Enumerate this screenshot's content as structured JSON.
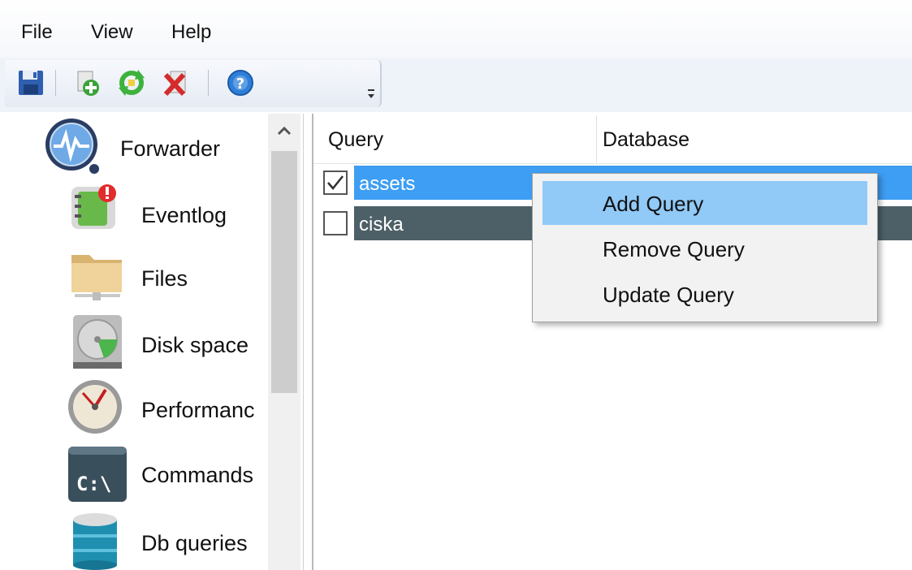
{
  "menubar": {
    "items": [
      {
        "label": "File"
      },
      {
        "label": "View"
      },
      {
        "label": "Help"
      }
    ]
  },
  "toolbar": {
    "buttons": [
      {
        "icon": "save-icon"
      },
      {
        "icon": "add-icon"
      },
      {
        "icon": "refresh-icon"
      },
      {
        "icon": "delete-icon"
      },
      {
        "icon": "help-icon"
      }
    ]
  },
  "sidebar": {
    "items": [
      {
        "label": "Forwarder",
        "icon": "forwarder-icon"
      },
      {
        "label": "Eventlog",
        "icon": "eventlog-icon"
      },
      {
        "label": "Files",
        "icon": "folder-icon"
      },
      {
        "label": "Disk space",
        "icon": "disk-icon"
      },
      {
        "label": "Performanc",
        "icon": "gauge-icon"
      },
      {
        "label": "Commands",
        "icon": "console-icon"
      },
      {
        "label": "Db queries",
        "icon": "database-icon"
      }
    ]
  },
  "list": {
    "columns": [
      "Query",
      "Database"
    ],
    "rows": [
      {
        "name": "assets",
        "checked": true,
        "state": "selected"
      },
      {
        "name": "ciska",
        "checked": false,
        "state": "inactive-selected"
      }
    ]
  },
  "context_menu": {
    "items": [
      {
        "label": "Add Query",
        "highlighted": true
      },
      {
        "label": "Remove Query",
        "highlighted": false
      },
      {
        "label": "Update Query",
        "highlighted": false
      }
    ]
  },
  "colors": {
    "selection": "#3d9ef3",
    "inactive_selection": "#4d6068",
    "menu_highlight": "#91c9f7",
    "menu_background": "#f2f2f2"
  }
}
